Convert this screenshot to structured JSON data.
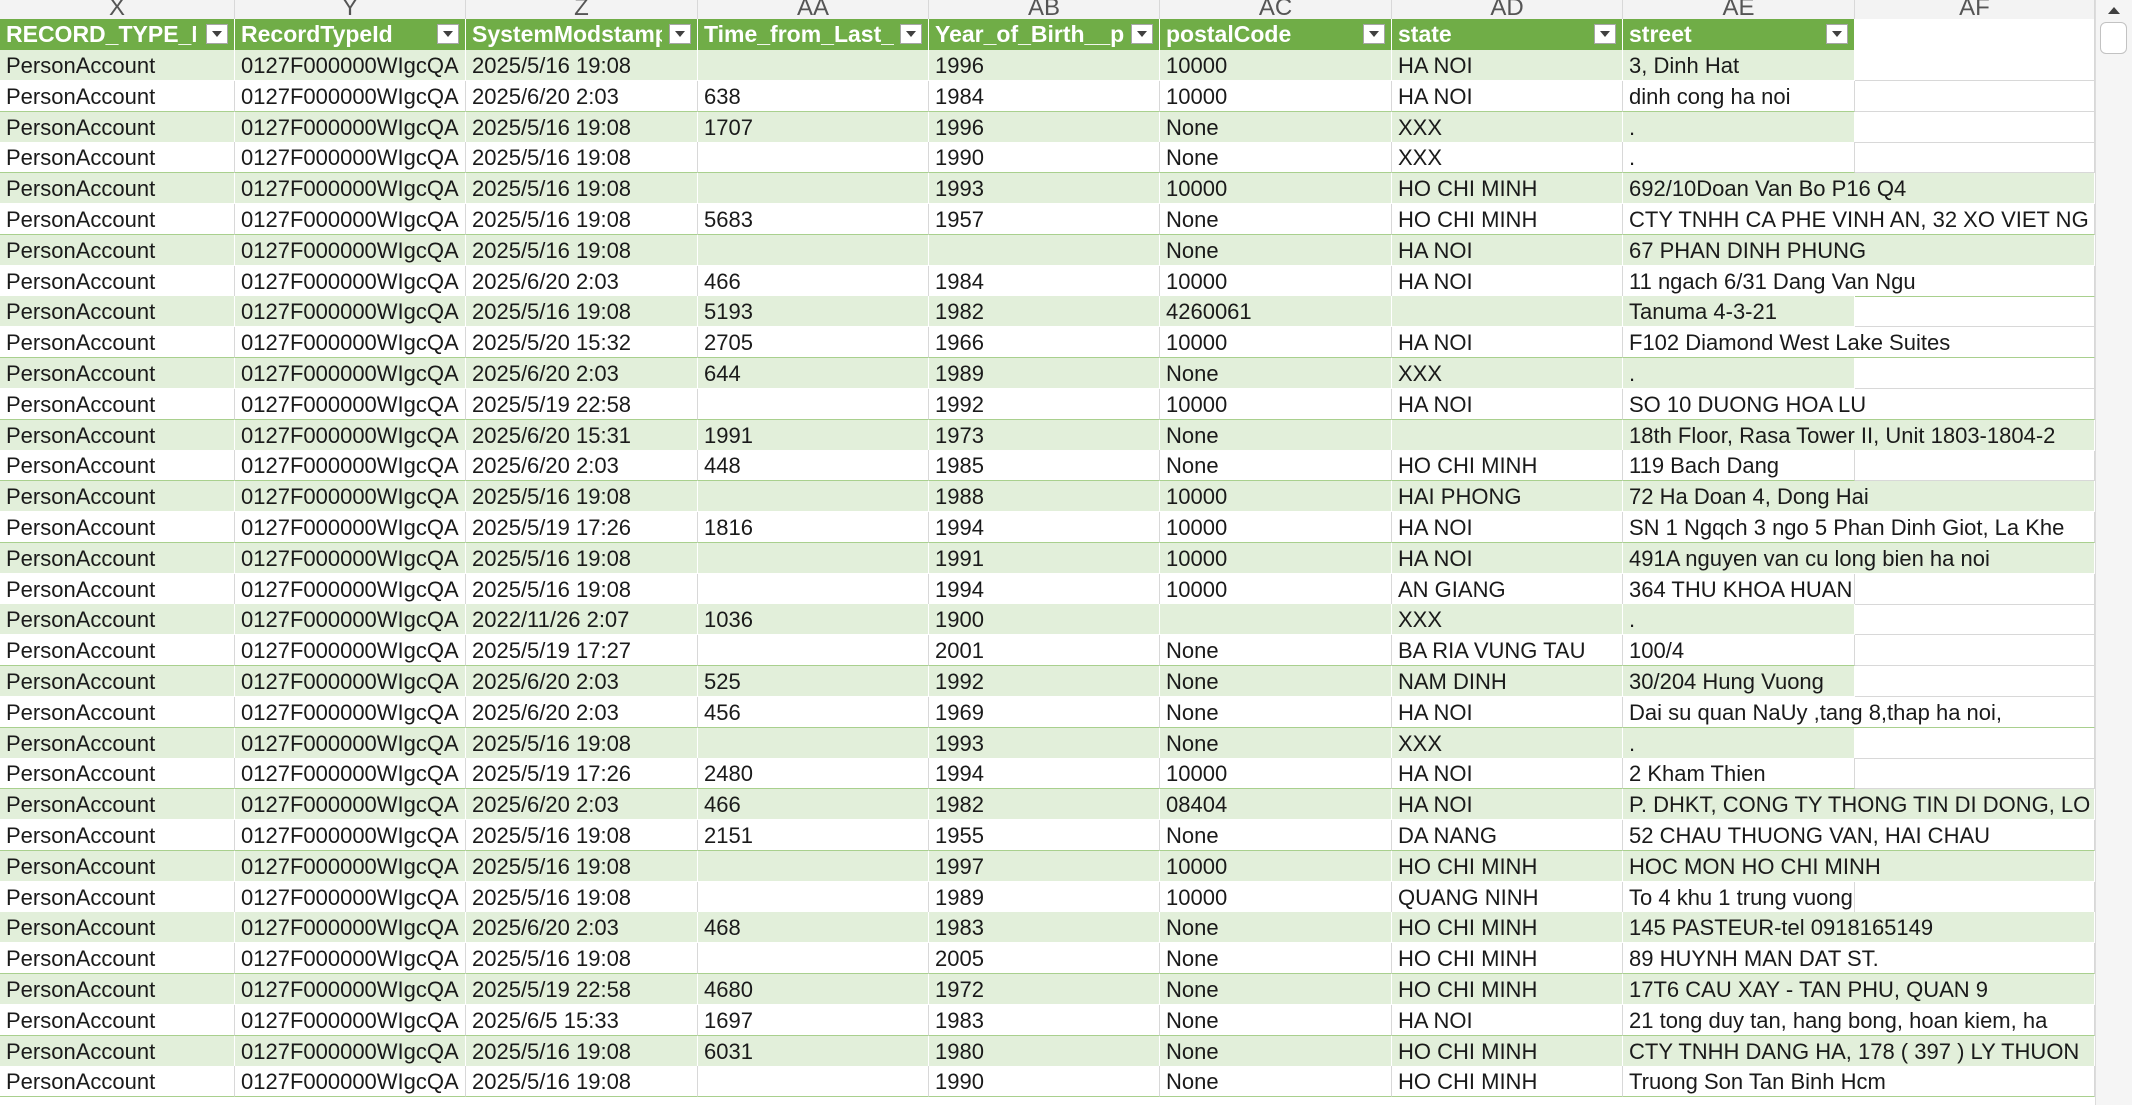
{
  "column_letters": [
    "X",
    "Y",
    "Z",
    "AA",
    "AB",
    "AC",
    "AD",
    "AE",
    "AF"
  ],
  "headers": [
    "RECORD_TYPE_NA",
    "RecordTypeId",
    "SystemModstamp",
    "Time_from_Last_Ti",
    "Year_of_Birth__pc",
    "postalCode",
    "state",
    "street"
  ],
  "icons": {
    "filter": "filter-dropdown-icon",
    "scroll_up": "chevron-up-icon"
  },
  "colors": {
    "header_bg": "#70ad47",
    "band_bg": "#e2efda",
    "header_text": "#ffffff"
  },
  "rows": [
    [
      "PersonAccount",
      "0127F000000WIgcQA",
      "2025/5/16 19:08",
      "",
      "1996",
      "10000",
      "HA NOI",
      "3, Dinh Hat"
    ],
    [
      "PersonAccount",
      "0127F000000WIgcQA",
      "2025/6/20 2:03",
      "638",
      "1984",
      "10000",
      "HA NOI",
      "dinh cong ha noi"
    ],
    [
      "PersonAccount",
      "0127F000000WIgcQA",
      "2025/5/16 19:08",
      "1707",
      "1996",
      "None",
      "XXX",
      "."
    ],
    [
      "PersonAccount",
      "0127F000000WIgcQA",
      "2025/5/16 19:08",
      "",
      "1990",
      "None",
      "XXX",
      "."
    ],
    [
      "PersonAccount",
      "0127F000000WIgcQA",
      "2025/5/16 19:08",
      "",
      "1993",
      "10000",
      "HO CHI MINH",
      "692/10Doan Van Bo P16 Q4"
    ],
    [
      "PersonAccount",
      "0127F000000WIgcQA",
      "2025/5/16 19:08",
      "5683",
      "1957",
      "None",
      "HO CHI MINH",
      "CTY TNHH CA PHE VINH AN, 32 XO VIET NG"
    ],
    [
      "PersonAccount",
      "0127F000000WIgcQA",
      "2025/5/16 19:08",
      "",
      "",
      "None",
      "HA NOI",
      "67 PHAN DINH PHUNG"
    ],
    [
      "PersonAccount",
      "0127F000000WIgcQA",
      "2025/6/20 2:03",
      "466",
      "1984",
      "10000",
      "HA NOI",
      "11 ngach 6/31 Dang Van Ngu"
    ],
    [
      "PersonAccount",
      "0127F000000WIgcQA",
      "2025/5/16 19:08",
      "5193",
      "1982",
      "4260061",
      "",
      "Tanuma 4-3-21"
    ],
    [
      "PersonAccount",
      "0127F000000WIgcQA",
      "2025/5/20 15:32",
      "2705",
      "1966",
      "10000",
      "HA NOI",
      "F102 Diamond West Lake Suites"
    ],
    [
      "PersonAccount",
      "0127F000000WIgcQA",
      "2025/6/20 2:03",
      "644",
      "1989",
      "None",
      "XXX",
      "."
    ],
    [
      "PersonAccount",
      "0127F000000WIgcQA",
      "2025/5/19 22:58",
      "",
      "1992",
      "10000",
      "HA NOI",
      "SO 10 DUONG HOA LU"
    ],
    [
      "PersonAccount",
      "0127F000000WIgcQA",
      "2025/6/20 15:31",
      "1991",
      "1973",
      "None",
      "",
      "18th Floor, Rasa Tower II, Unit 1803-1804-2"
    ],
    [
      "PersonAccount",
      "0127F000000WIgcQA",
      "2025/6/20 2:03",
      "448",
      "1985",
      "None",
      "HO CHI MINH",
      "119 Bach Dang"
    ],
    [
      "PersonAccount",
      "0127F000000WIgcQA",
      "2025/5/16 19:08",
      "",
      "1988",
      "10000",
      "HAI PHONG",
      "72 Ha Doan 4, Dong Hai"
    ],
    [
      "PersonAccount",
      "0127F000000WIgcQA",
      "2025/5/19 17:26",
      "1816",
      "1994",
      "10000",
      "HA NOI",
      "SN 1 Ngqch 3 ngo 5 Phan Dinh Giot, La Khe"
    ],
    [
      "PersonAccount",
      "0127F000000WIgcQA",
      "2025/5/16 19:08",
      "",
      "1991",
      "10000",
      "HA NOI",
      "491A nguyen van cu long bien ha noi"
    ],
    [
      "PersonAccount",
      "0127F000000WIgcQA",
      "2025/5/16 19:08",
      "",
      "1994",
      "10000",
      "AN GIANG",
      "364 THU KHOA HUAN"
    ],
    [
      "PersonAccount",
      "0127F000000WIgcQA",
      "2022/11/26 2:07",
      "1036",
      "1900",
      "",
      "XXX",
      "."
    ],
    [
      "PersonAccount",
      "0127F000000WIgcQA",
      "2025/5/19 17:27",
      "",
      "2001",
      "None",
      "BA RIA VUNG TAU",
      "100/4"
    ],
    [
      "PersonAccount",
      "0127F000000WIgcQA",
      "2025/6/20 2:03",
      "525",
      "1992",
      "None",
      "NAM DINH",
      "30/204 Hung Vuong"
    ],
    [
      "PersonAccount",
      "0127F000000WIgcQA",
      "2025/6/20 2:03",
      "456",
      "1969",
      "None",
      "HA NOI",
      "Dai su quan NaUy ,tang 8,thap ha noi,"
    ],
    [
      "PersonAccount",
      "0127F000000WIgcQA",
      "2025/5/16 19:08",
      "",
      "1993",
      "None",
      "XXX",
      "."
    ],
    [
      "PersonAccount",
      "0127F000000WIgcQA",
      "2025/5/19 17:26",
      "2480",
      "1994",
      "10000",
      "HA NOI",
      "2 Kham Thien"
    ],
    [
      "PersonAccount",
      "0127F000000WIgcQA",
      "2025/6/20 2:03",
      "466",
      "1982",
      "08404",
      "HA NOI",
      "P. DHKT, CONG TY THONG TIN DI DONG, LO"
    ],
    [
      "PersonAccount",
      "0127F000000WIgcQA",
      "2025/5/16 19:08",
      "2151",
      "1955",
      "None",
      "DA NANG",
      "52 CHAU THUONG VAN, HAI CHAU"
    ],
    [
      "PersonAccount",
      "0127F000000WIgcQA",
      "2025/5/16 19:08",
      "",
      "1997",
      "10000",
      "HO CHI MINH",
      "HOC MON HO CHI MINH"
    ],
    [
      "PersonAccount",
      "0127F000000WIgcQA",
      "2025/5/16 19:08",
      "",
      "1989",
      "10000",
      "QUANG NINH",
      "To 4 khu 1 trung vuong"
    ],
    [
      "PersonAccount",
      "0127F000000WIgcQA",
      "2025/6/20 2:03",
      "468",
      "1983",
      "None",
      "HO CHI MINH",
      "145 PASTEUR-tel 0918165149"
    ],
    [
      "PersonAccount",
      "0127F000000WIgcQA",
      "2025/5/16 19:08",
      "",
      "2005",
      "None",
      "HO CHI MINH",
      "89 HUYNH MAN DAT ST."
    ],
    [
      "PersonAccount",
      "0127F000000WIgcQA",
      "2025/5/19 22:58",
      "4680",
      "1972",
      "None",
      "HO CHI MINH",
      "17T6 CAU XAY - TAN PHU, QUAN 9"
    ],
    [
      "PersonAccount",
      "0127F000000WIgcQA",
      "2025/6/5 15:33",
      "1697",
      "1983",
      "None",
      "HA NOI",
      "21 tong duy tan, hang bong, hoan kiem, ha"
    ],
    [
      "PersonAccount",
      "0127F000000WIgcQA",
      "2025/5/16 19:08",
      "6031",
      "1980",
      "None",
      "HO CHI MINH",
      "CTY TNHH DANG HA, 178 ( 397 ) LY THUON"
    ],
    [
      "PersonAccount",
      "0127F000000WIgcQA",
      "2025/5/16 19:08",
      "",
      "1990",
      "None",
      "HO CHI MINH",
      "Truong Son Tan Binh Hcm"
    ]
  ]
}
